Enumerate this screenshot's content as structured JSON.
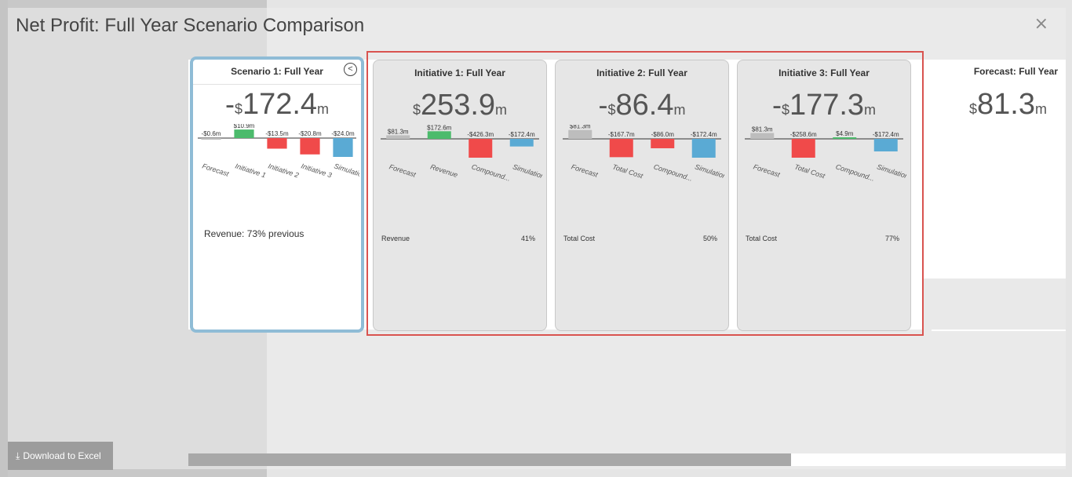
{
  "modal": {
    "title": "Net Profit: Full Year Scenario Comparison",
    "close_label": "×",
    "download_label": "Download to Excel"
  },
  "scenario": {
    "title": "Scenario 1: Full Year",
    "sign": "-",
    "currency": "$",
    "value": "172.4",
    "unit": "m",
    "footer_text": "Revenue: 73%  previous",
    "bars": [
      {
        "label": "Forecast",
        "value": "-$0.6m",
        "color": "#bdbdbd"
      },
      {
        "label": "Initiative 1",
        "value": "$10.9m",
        "color": "#4cbb6c"
      },
      {
        "label": "Initiative 2",
        "value": "-$13.5m",
        "color": "#f04a4a"
      },
      {
        "label": "Initiative 3",
        "value": "-$20.8m",
        "color": "#f04a4a"
      },
      {
        "label": "Simulation",
        "value": "-$24.0m",
        "color": "#5aaad4"
      }
    ]
  },
  "initiatives": [
    {
      "title": "Initiative 1: Full Year",
      "sign": "",
      "currency": "$",
      "value": "253.9",
      "unit": "m",
      "footer_label": "Revenue",
      "footer_pct": "41%",
      "bars": [
        {
          "label": "Forecast",
          "value": "$81.3m",
          "color": "#bdbdbd"
        },
        {
          "label": "Revenue",
          "value": "$172.6m",
          "color": "#4cbb6c"
        },
        {
          "label": "Compound...",
          "value": "-$426.3m",
          "color": "#f04a4a"
        },
        {
          "label": "Simulation",
          "value": "-$172.4m",
          "color": "#5aaad4"
        }
      ]
    },
    {
      "title": "Initiative 2: Full Year",
      "sign": "-",
      "currency": "$",
      "value": "86.4",
      "unit": "m",
      "footer_label": "Total Cost",
      "footer_pct": "50%",
      "bars": [
        {
          "label": "Forecast",
          "value": "$81.3m",
          "color": "#bdbdbd"
        },
        {
          "label": "Total Cost",
          "value": "-$167.7m",
          "color": "#f04a4a"
        },
        {
          "label": "Compound...",
          "value": "-$86.0m",
          "color": "#f04a4a"
        },
        {
          "label": "Simulation",
          "value": "-$172.4m",
          "color": "#5aaad4"
        }
      ]
    },
    {
      "title": "Initiative 3: Full Year",
      "sign": "-",
      "currency": "$",
      "value": "177.3",
      "unit": "m",
      "footer_label": "Total Cost",
      "footer_pct": "77%",
      "bars": [
        {
          "label": "Forecast",
          "value": "$81.3m",
          "color": "#bdbdbd"
        },
        {
          "label": "Total Cost",
          "value": "-$258.6m",
          "color": "#f04a4a"
        },
        {
          "label": "Compound...",
          "value": "$4.9m",
          "color": "#4cbb6c"
        },
        {
          "label": "Simulation",
          "value": "-$172.4m",
          "color": "#5aaad4"
        }
      ]
    }
  ],
  "forecast": {
    "title": "Forecast: Full Year",
    "currency": "$",
    "value": "81.3",
    "unit": "m"
  }
}
